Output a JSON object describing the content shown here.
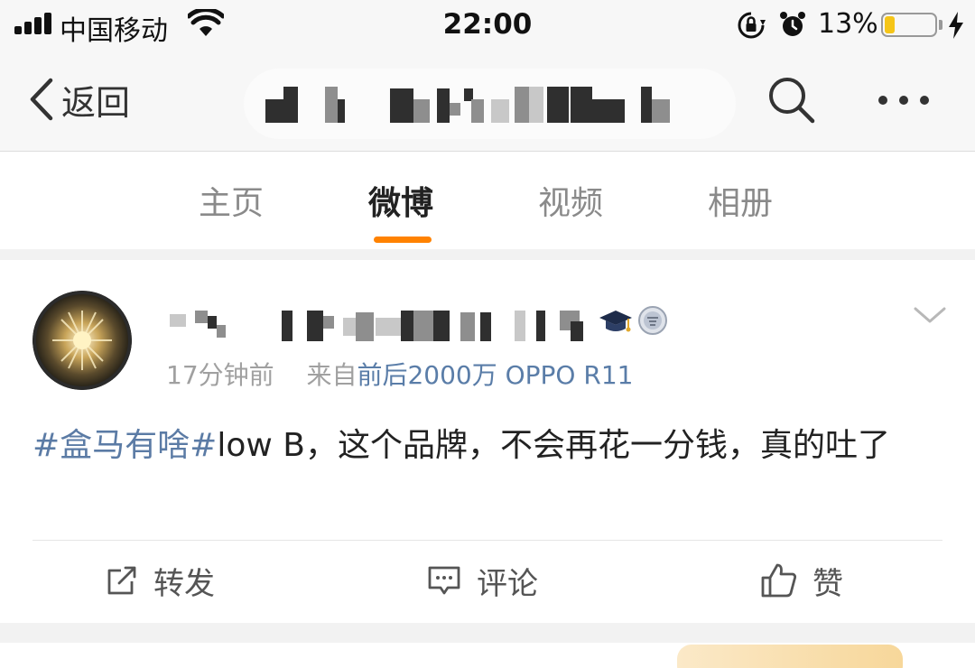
{
  "status_bar": {
    "carrier": "中国移动",
    "time": "22:00",
    "battery_percent": "13%",
    "battery_level": 0.13,
    "icons": [
      "signal-icon",
      "wifi-icon",
      "orientation-lock-icon",
      "alarm-icon",
      "battery-icon",
      "charging-icon"
    ]
  },
  "nav": {
    "back_label": "返回",
    "icons": [
      "back-chevron-icon",
      "search-icon",
      "more-icon"
    ]
  },
  "tabs": [
    {
      "label": "主页",
      "active": false
    },
    {
      "label": "微博",
      "active": true
    },
    {
      "label": "视频",
      "active": false
    },
    {
      "label": "相册",
      "active": false
    }
  ],
  "accent_color": "#ff8200",
  "link_color": "#5b7ba5",
  "post": {
    "time_ago": "17分钟前",
    "source_prefix": "来自",
    "source": "前后2000万 OPPO R11",
    "text_topic": "#盒马有啥#",
    "text_body": "low B，这个品牌，不会再花一分钱，真的吐了",
    "badges": [
      "graduation-cap-icon",
      "honor-medal-icon"
    ],
    "actions": {
      "repost": "转发",
      "comment": "评论",
      "like": "赞"
    }
  }
}
